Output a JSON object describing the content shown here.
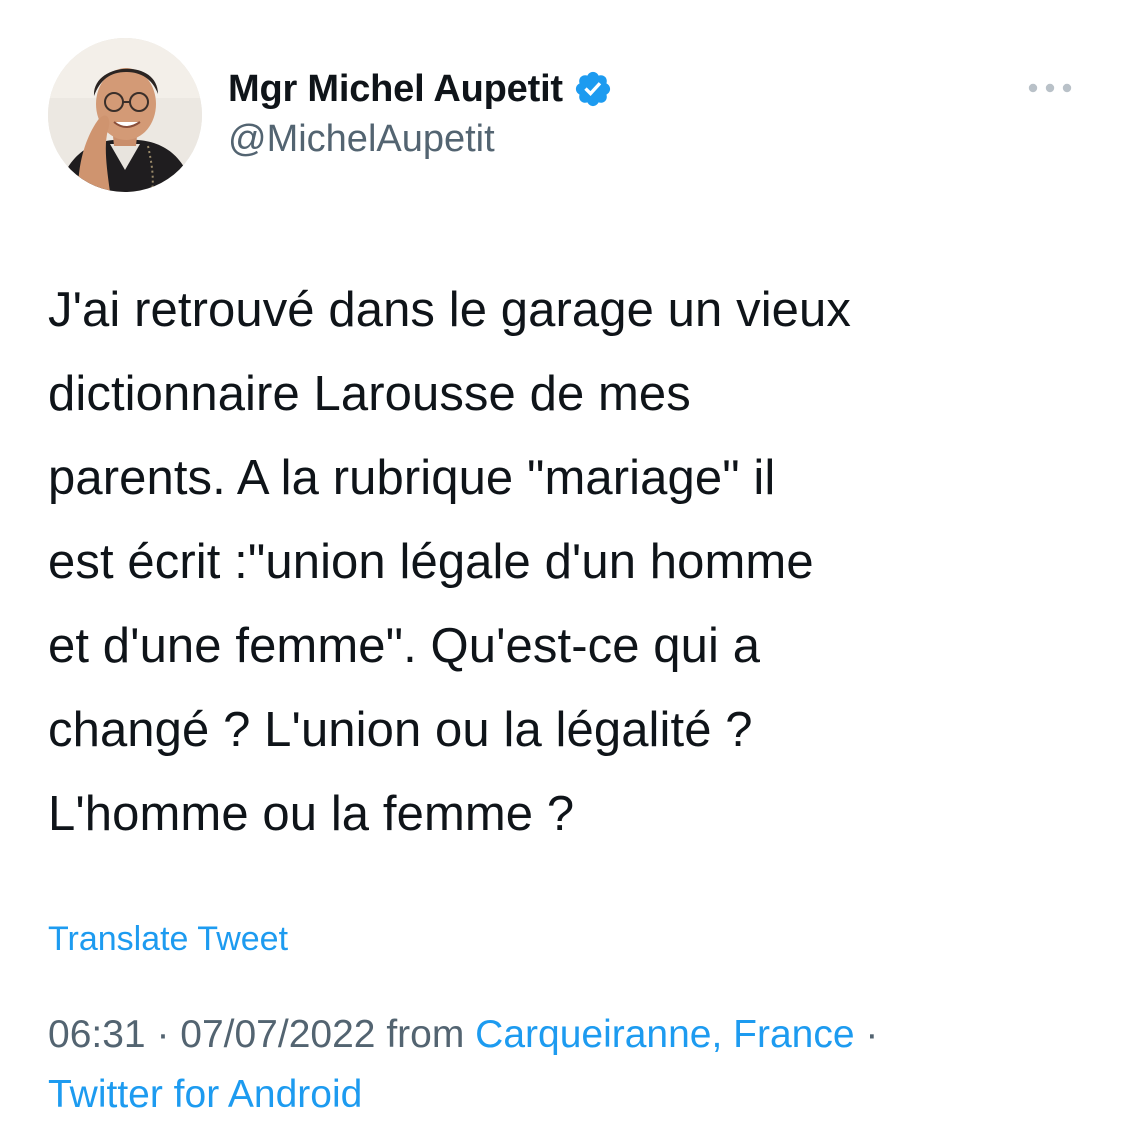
{
  "author": {
    "display_name": "Mgr Michel Aupetit",
    "handle": "@MichelAupetit",
    "verified": true,
    "avatar_icon": "profile-photo-avatar"
  },
  "tweet": {
    "text": "J'ai retrouvé dans le garage un vieux\ndictionnaire Larousse de mes\nparents. A la rubrique \"mariage\" il\nest écrit :\"union légale d'un homme\net d'une femme\". Qu'est-ce qui a\nchangé ? L'union ou la légalité ?\nL'homme ou la femme ?",
    "translate_label": "Translate Tweet"
  },
  "meta": {
    "time": "06:31",
    "separator": " · ",
    "date": "07/07/2022",
    "from_label": " from ",
    "location": "Carqueiranne, France",
    "separator2": " ·",
    "source": "Twitter for Android"
  },
  "icons": {
    "verified": "verified-badge-icon",
    "more": "more-dots-icon"
  },
  "colors": {
    "text": "#0f1419",
    "secondary": "#536471",
    "accent": "#1d9bf0"
  }
}
